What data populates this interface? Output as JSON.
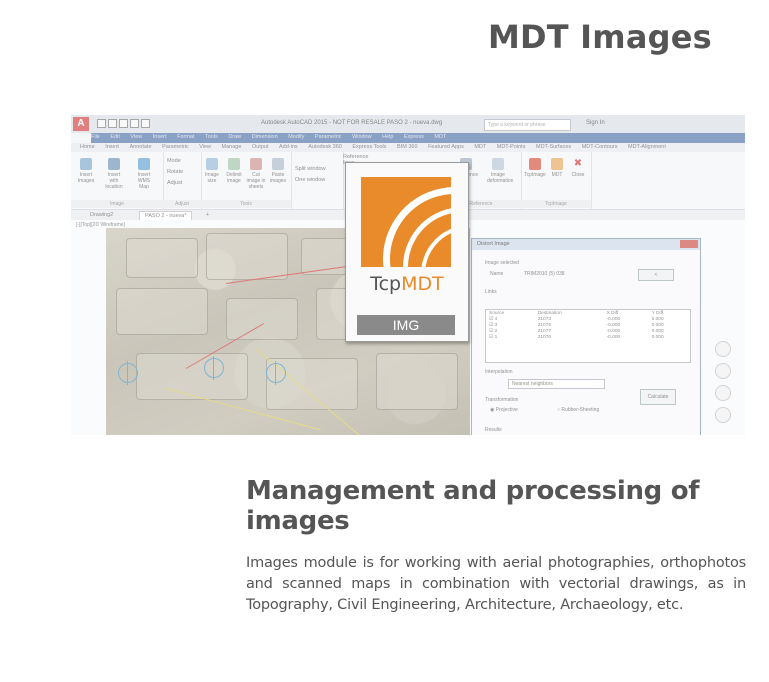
{
  "page": {
    "title": "MDT Images",
    "section_title": "Management and processing of images",
    "section_body": "Images module is for working with aerial photographies, orthophotos and scanned maps in combination with vectorial drawings, as in Topography, Civil Engineering, Architecture, Archaeology, etc."
  },
  "screenshot": {
    "app_logo": "A",
    "window_title": "Autodesk AutoCAD 2015 - NOT FOR RESALE    PASO 2 - nueva.dwg",
    "search_placeholder": "Type a keyword or phrase",
    "signin_label": "Sign In",
    "menu_items": [
      "File",
      "Edit",
      "View",
      "Insert",
      "Format",
      "Tools",
      "Draw",
      "Dimension",
      "Modify",
      "Parametric",
      "Window",
      "Help",
      "Express",
      "MDT"
    ],
    "ribbon_tabs": [
      "Home",
      "Insert",
      "Annotate",
      "Parametric",
      "View",
      "Manage",
      "Output",
      "Add-ins",
      "Autodesk 360",
      "Express Tools",
      "BIM 360",
      "Featured Apps",
      "MDT",
      "MDT-Points",
      "MDT-Surfaces",
      "MDT-Contours",
      "MDT-Alignment"
    ],
    "ribbon_groups": {
      "image": {
        "label": "Image",
        "buttons": [
          "Insert Images",
          "Insert with location",
          "Insert WMS Map"
        ]
      },
      "adjust": {
        "label": "Adjust",
        "items": [
          "Mode",
          "Rotate",
          "Adjust"
        ]
      },
      "tools": {
        "label": "Tools",
        "buttons": [
          "Image size",
          "Delimit image",
          "Cut image in sheets",
          "Paste images"
        ]
      },
      "window": {
        "items": [
          "Split window",
          "One window",
          "Reference lines"
        ]
      },
      "reference": {
        "label": "Reference",
        "buttons": [
          "Reference",
          "Image deformation"
        ]
      },
      "tcpimage": {
        "label": "TcpImage",
        "buttons": [
          "TcpImage",
          "MDT",
          "Close"
        ]
      }
    },
    "doc_tabs": [
      "Drawing2",
      "PASO 2 - nueva*",
      "+"
    ],
    "viewport_label": "[-][Top][2D Wireframe]",
    "logo": {
      "text_prefix": "Tcp",
      "text_accent": "MDT",
      "tag": "IMG",
      "accent_color": "#e98b2a"
    },
    "dialog": {
      "title": "Distort Image",
      "image_selected_label": "Image selected",
      "name_label": "Name",
      "name_value": "TRIM2010 (5) 038",
      "links_label": "Links",
      "columns": [
        "Source",
        "Destination",
        "X Diff",
        "Y Diff"
      ],
      "rows": [
        [
          "4",
          "21073",
          "-0.000",
          "0.000"
        ],
        [
          "3",
          "21075",
          "-0.000",
          "0.000"
        ],
        [
          "2",
          "21077",
          "-0.000",
          "0.000"
        ],
        [
          "1",
          "21076",
          "-0.000",
          "0.000"
        ]
      ],
      "interpolation_label": "Interpolation",
      "interpolation_value": "Nearest neighbors",
      "transformation_label": "Transformation",
      "option_projective": "Projective",
      "option_rubber": "Rubber-Sheeting",
      "calculate_label": "Calculate",
      "results_label": "Results"
    }
  }
}
